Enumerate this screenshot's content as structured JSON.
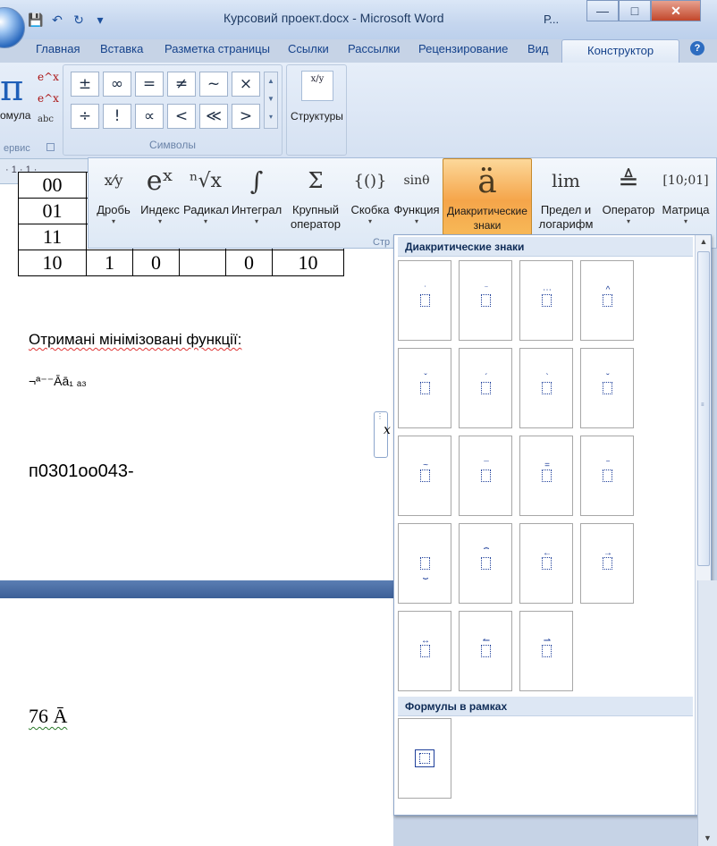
{
  "window": {
    "title": "Курсовий проект.docx - Microsoft Word",
    "title_extra": "Р...",
    "controls": {
      "minimize": "—",
      "maximize": "□",
      "close": "✕"
    }
  },
  "quick_access": {
    "save": "💾",
    "undo": "↶",
    "redo": "↻",
    "customize": "▾"
  },
  "tabs": [
    "Главная",
    "Вставка",
    "Разметка страницы",
    "Ссылки",
    "Рассылки",
    "Рецензирование",
    "Вид",
    "Конструктор"
  ],
  "help": "?",
  "ribbon": {
    "formula_label": "омула",
    "service_label": "ервис",
    "exp_icons": [
      "e^x",
      "e^x",
      "abc"
    ],
    "symbols": [
      "±",
      "∞",
      "=",
      "≠",
      "~",
      "×",
      "÷",
      "!",
      "∝",
      "<",
      "≪",
      ">"
    ],
    "symbols_group_label": "Символы",
    "structures_label": "Структуры",
    "structures_icon": "x/y"
  },
  "ruler_text": "· 1 · 1 ·",
  "structures": [
    {
      "icon": "x⁄y",
      "label": "Дробь",
      "label2": ""
    },
    {
      "icon": "eˣ",
      "label": "Индекс",
      "label2": ""
    },
    {
      "icon": "ⁿ√x",
      "label": "Радикал",
      "label2": ""
    },
    {
      "icon": "∫",
      "label": "Интеграл",
      "label2": ""
    },
    {
      "icon": "Σ",
      "label": "Крупный",
      "label2": "оператор"
    },
    {
      "icon": "{()}",
      "label": "Скобка",
      "label2": ""
    },
    {
      "icon": "sinθ",
      "label": "Функция",
      "label2": ""
    },
    {
      "icon": "ä",
      "label": "Диакритические",
      "label2": "знаки"
    },
    {
      "icon": "lim",
      "label": "Предел и",
      "label2": "логарифм"
    },
    {
      "icon": "≜",
      "label": "Оператор",
      "label2": ""
    },
    {
      "icon": "[10;01]",
      "label": "Матрица",
      "label2": ""
    }
  ],
  "structures_footer": "Стр",
  "gallery": {
    "section1_title": "Диакритические знаки",
    "section2_title": "Формулы в рамках",
    "accents": [
      "˙",
      "¨",
      "⋯",
      "^",
      "ˇ",
      "´",
      "`",
      "˘",
      "~",
      "¯",
      "=",
      "‾",
      "⏟",
      "⏞",
      "←",
      "→",
      "↔",
      "↼",
      "⇀"
    ],
    "accent_positions": [
      "top",
      "top",
      "top",
      "top",
      "top",
      "top",
      "top",
      "top",
      "top",
      "top",
      "top",
      "top",
      "bottom",
      "top",
      "top",
      "top",
      "top",
      "top",
      "top",
      "top"
    ]
  },
  "document": {
    "table_rows": [
      [
        "00",
        "",
        "",
        "",
        "",
        ""
      ],
      [
        "01",
        "",
        "",
        "",
        "",
        ""
      ],
      [
        "11",
        "",
        "",
        "",
        "",
        ""
      ],
      [
        "10",
        "1",
        "0",
        "",
        "0",
        "10"
      ]
    ],
    "heading": "Отримані мінімізовані функції:",
    "formula_line": "¬ª⁻⁻Āā₁ ₐ₃",
    "code_line": "п0301оо043-",
    "bottom_text": "76 Ā"
  }
}
